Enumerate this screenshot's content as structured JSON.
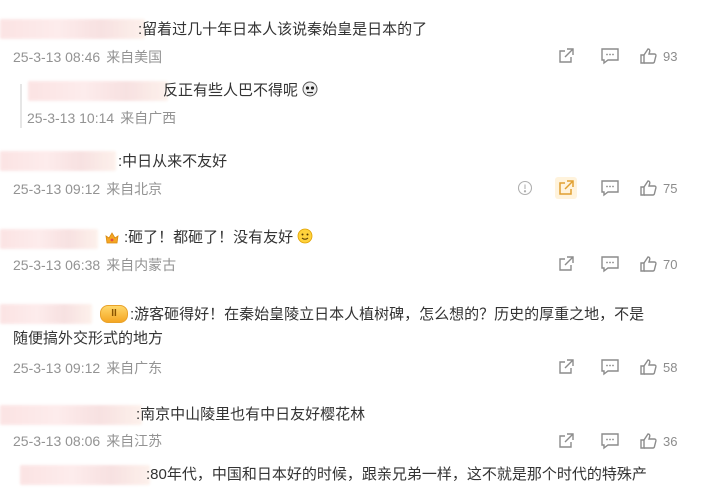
{
  "comments": [
    {
      "text": ":留着过几十年日本人该说秦始皇是日本的了",
      "date": "25-3-13 08:46",
      "location": "来自美国",
      "likes": "93"
    },
    {
      "text": "反正有些人巴不得呢",
      "date": "25-3-13 10:14",
      "location": "来自广西",
      "is_reply": true
    },
    {
      "text": ":中日从来不友好",
      "date": "25-3-13 09:12",
      "location": "来自北京",
      "likes": "75"
    },
    {
      "text": ":砸了！都砸了！没有友好",
      "date": "25-3-13 06:38",
      "location": "来自内蒙古",
      "likes": "70"
    },
    {
      "text_line1": ":游客砸得好！在秦始皇陵立日本人植树碑，怎么想的？历史的厚重之地，不是",
      "text_line2": "随便搞外交形式的地方",
      "date": "25-3-13 09:12",
      "location": "来自广东",
      "likes": "58"
    },
    {
      "text": ":南京中山陵里也有中日友好樱花林",
      "date": "25-3-13 08:06",
      "location": "来自江苏",
      "likes": "36"
    },
    {
      "text": ":80年代，中国和日本好的时候，跟亲兄弟一样，这不就是那个时代的特殊产"
    }
  ],
  "badge_text": "II",
  "colors": {
    "meta_gray": "#939393",
    "icon_gray": "#8c8c8c",
    "highlight": "#fff3dc"
  },
  "icons": [
    "share-icon",
    "reply-icon",
    "like-icon",
    "report-icon"
  ]
}
